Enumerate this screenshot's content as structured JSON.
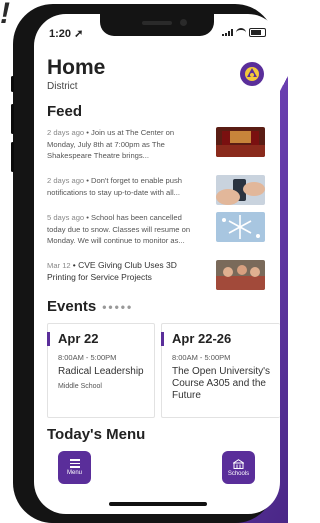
{
  "corner_mark": "!",
  "status_bar": {
    "time": "1:20 ➚"
  },
  "header": {
    "title": "Home",
    "subtitle": "District",
    "avatar_icon": "mascot-logo"
  },
  "feed": {
    "title": "Feed",
    "items": [
      {
        "date": "2 days ago",
        "text": "• Join us at The Center on Monday, July 8th at 7:00pm as The Shakespeare Theatre brings...",
        "thumb": "theater-image"
      },
      {
        "date": "2 days ago",
        "text": "• Don't forget to enable push notifications to stay up-to-date with all...",
        "thumb": "phone-hands-image"
      },
      {
        "date": "5 days ago",
        "text": "• School has been cancelled today due to snow. Classes will resume on Monday. We will continue to monitor as...",
        "thumb": "snowflake-image"
      },
      {
        "date": "Mar 12",
        "text": "• CVE Giving Club Uses 3D Printing for Service Projects",
        "thumb": "classroom-image"
      }
    ]
  },
  "events": {
    "title": "Events",
    "cards": [
      {
        "date": "Apr 22",
        "time": "8:00AM  -  5:00PM",
        "title": "Radical Leadership",
        "location": "Middle School"
      },
      {
        "date": "Apr 22-26",
        "time": "8:00AM  -  5:00PM",
        "title": "The Open University's Course A305 and the Future",
        "location": ""
      }
    ]
  },
  "menu": {
    "title": "Today's Menu"
  },
  "fab": {
    "menu_label": "Menu",
    "schools_label": "Schools"
  },
  "colors": {
    "accent": "#5a2e9a",
    "background_stripe": "#6a3fb0"
  }
}
